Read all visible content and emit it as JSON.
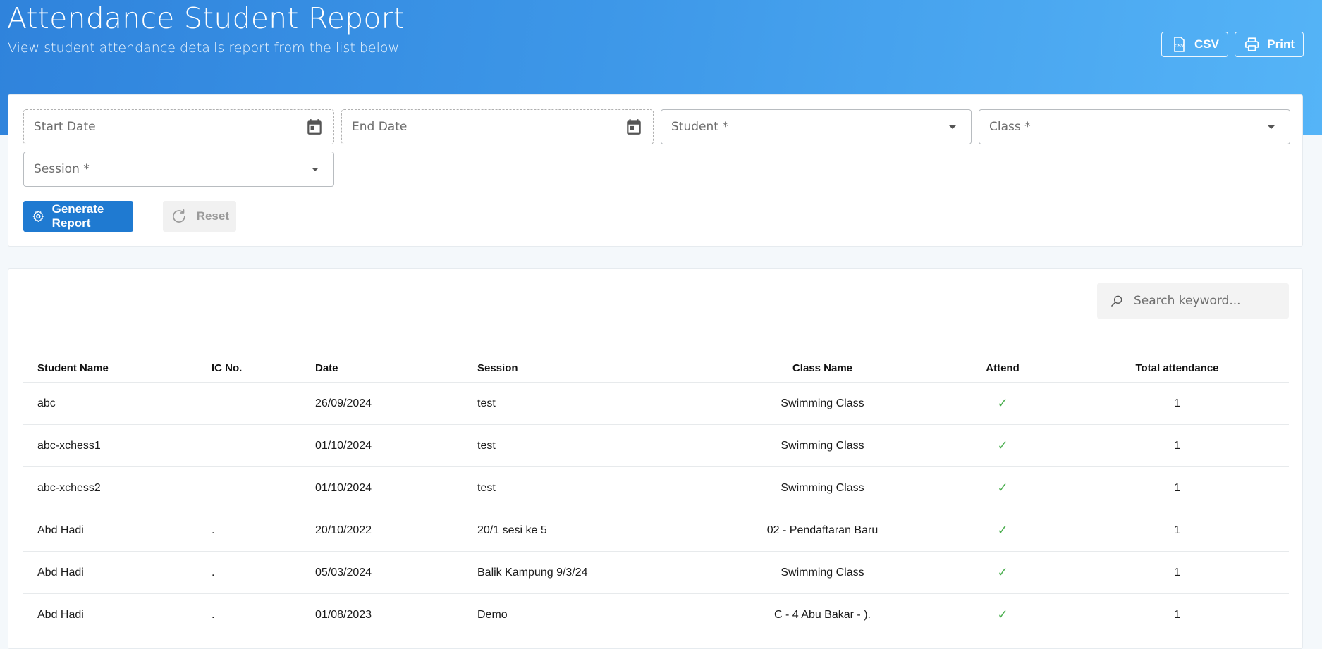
{
  "header": {
    "title": "Attendance Student Report",
    "subtitle": "View student attendance details report from the list below",
    "csv_label": "CSV",
    "print_label": "Print",
    "csv_icon": "csv-file-icon",
    "print_icon": "printer-icon"
  },
  "filters": {
    "start_date": "Start Date",
    "end_date": "End Date",
    "student": "Student *",
    "class": "Class *",
    "session": "Session *",
    "generate_label": "Generate Report",
    "reset_label": "Reset"
  },
  "search": {
    "placeholder": "Search keyword..."
  },
  "table": {
    "columns": [
      "Student Name",
      "IC No.",
      "Date",
      "Session",
      "Class Name",
      "Attend",
      "Total attendance"
    ],
    "rows": [
      {
        "name": "abc",
        "ic": "",
        "date": "26/09/2024",
        "session": "test",
        "class": "Swimming Class",
        "attend": "✓",
        "total": "1"
      },
      {
        "name": "abc-xchess1",
        "ic": "",
        "date": "01/10/2024",
        "session": "test",
        "class": "Swimming Class",
        "attend": "✓",
        "total": "1"
      },
      {
        "name": "abc-xchess2",
        "ic": "",
        "date": "01/10/2024",
        "session": "test",
        "class": "Swimming Class",
        "attend": "✓",
        "total": "1"
      },
      {
        "name": "Abd Hadi",
        "ic": ".",
        "date": "20/10/2022",
        "session": "20/1 sesi ke 5",
        "class": "02 - Pendaftaran Baru",
        "attend": "✓",
        "total": "1"
      },
      {
        "name": "Abd Hadi",
        "ic": ".",
        "date": "05/03/2024",
        "session": "Balik Kampung 9/3/24",
        "class": "Swimming Class",
        "attend": "✓",
        "total": "1"
      },
      {
        "name": "Abd Hadi",
        "ic": ".",
        "date": "01/08/2023",
        "session": "Demo",
        "class": "C - 4 Abu Bakar - ).",
        "attend": "✓",
        "total": "1"
      }
    ]
  },
  "colors": {
    "primary": "#1f7ad1",
    "banner_start": "#2f83dc",
    "banner_end": "#55b4f7",
    "check": "#4caf50"
  }
}
